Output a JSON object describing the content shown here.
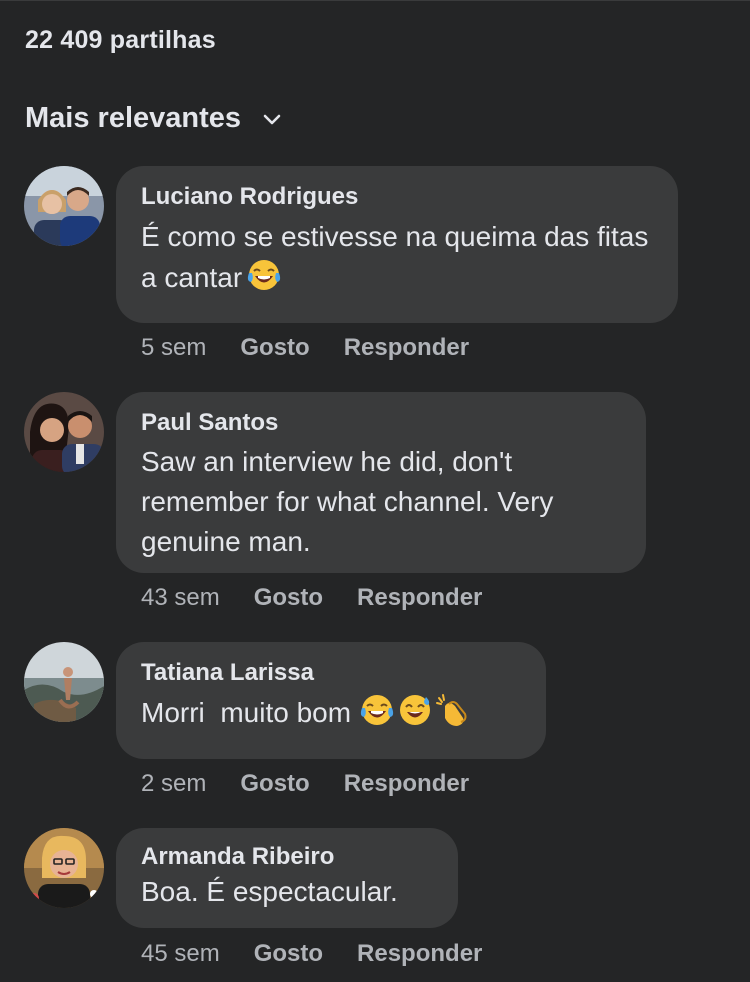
{
  "shares_text": "22 409 partilhas",
  "sort": {
    "label": "Mais relevantes",
    "icon": "chevron-down-icon"
  },
  "comments": [
    {
      "author": "Luciano Rodrigues",
      "text": "É como se estivesse na queima das fitas a cantar",
      "emojis": [
        "laughing-tears-emoji"
      ],
      "time": "5 sem",
      "like_label": "Gosto",
      "reply_label": "Responder"
    },
    {
      "author": "Paul Santos",
      "text": "Saw an interview he did, don't remember for what channel. Very genuine man.",
      "emojis": [],
      "time": "43 sem",
      "like_label": "Gosto",
      "reply_label": "Responder"
    },
    {
      "author": "Tatiana Larissa",
      "text": "Morri  muito bom",
      "emojis": [
        "laughing-tears-emoji",
        "sweat-smile-emoji",
        "clapping-hands-emoji"
      ],
      "time": "2 sem",
      "like_label": "Gosto",
      "reply_label": "Responder"
    },
    {
      "author": "Armanda Ribeiro",
      "text": "Boa. É espectacular.",
      "emojis": [],
      "time": "45 sem",
      "like_label": "Gosto",
      "reply_label": "Responder"
    }
  ],
  "colors": {
    "background": "#242526",
    "bubble": "#3a3b3c",
    "primary_text": "#e4e6eb",
    "secondary_text": "#b0b3b8"
  }
}
